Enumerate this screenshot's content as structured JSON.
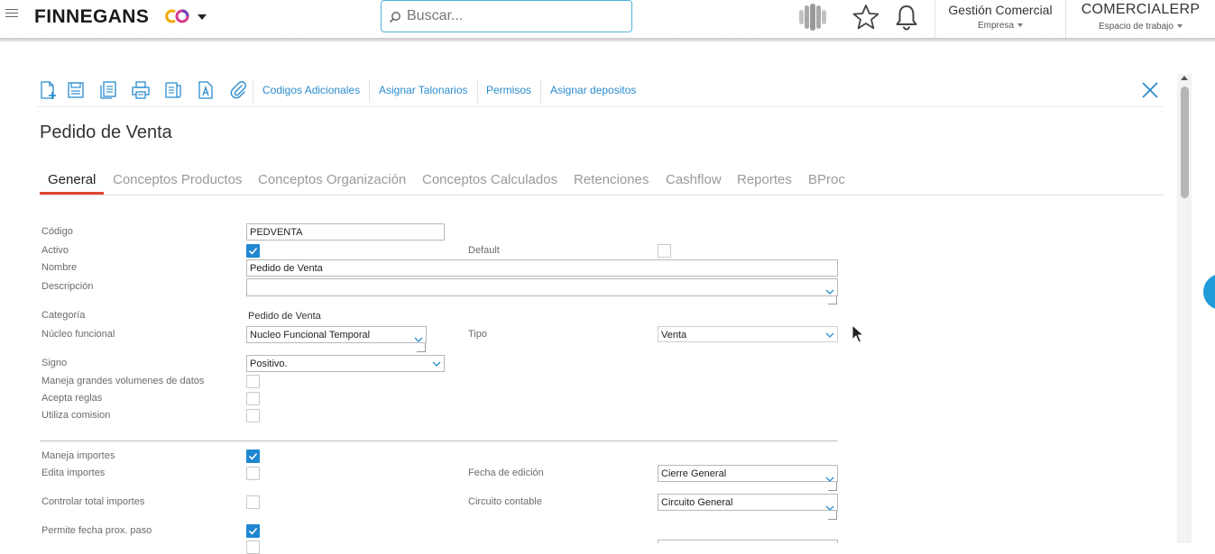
{
  "header": {
    "brand": "FINNEGANS",
    "search_placeholder": "Buscar...",
    "company": {
      "name": "Gestión Comercial",
      "label": "Empresa"
    },
    "workspace": {
      "name": "COMERCIALERP",
      "label": "Espacio de trabajo"
    },
    "icons": [
      "hamburger-icon",
      "finnegans-logo",
      "search-icon",
      "spinner-icon",
      "star-icon",
      "bell-icon"
    ]
  },
  "toolbar": {
    "icons": [
      "new-document-icon",
      "save-icon",
      "copy-icon",
      "print-icon",
      "report-icon",
      "text-icon",
      "attach-icon"
    ],
    "links": [
      "Codigos Adicionales",
      "Asignar Talonarios",
      "Permisos",
      "Asignar depositos"
    ]
  },
  "page_title": "Pedido de Venta",
  "tabs": [
    "General",
    "Conceptos Productos",
    "Conceptos Organización",
    "Conceptos Calculados",
    "Retenciones",
    "Cashflow",
    "Reportes",
    "BProc"
  ],
  "active_tab": "General",
  "form": {
    "codigo": {
      "label": "Código",
      "value": "PEDVENTA"
    },
    "activo": {
      "label": "Activo",
      "checked": true
    },
    "default": {
      "label": "Default",
      "checked": false
    },
    "nombre": {
      "label": "Nombre",
      "value": "Pedido de Venta"
    },
    "descripcion": {
      "label": "Descripción",
      "value": ""
    },
    "categoria": {
      "label": "Categoría",
      "value": "Pedido de Venta"
    },
    "nucleo": {
      "label": "Núcleo funcional",
      "value": "Nucleo Funcional Temporal"
    },
    "tipo": {
      "label": "Tipo",
      "value": "Venta"
    },
    "signo": {
      "label": "Signo",
      "value": "Positivo."
    },
    "grandes_volumenes": {
      "label": "Maneja grandes volumenes de datos",
      "checked": false
    },
    "acepta_reglas": {
      "label": "Acepta reglas",
      "checked": false
    },
    "utiliza_comision": {
      "label": "Utiliza comision",
      "checked": false
    },
    "maneja_importes": {
      "label": "Maneja importes",
      "checked": true
    },
    "edita_importes": {
      "label": "Edita importes",
      "checked": false
    },
    "fecha_edicion": {
      "label": "Fecha de edición",
      "value": "Cierre General"
    },
    "controlar_total": {
      "label": "Controlar total importes",
      "checked": false
    },
    "circuito_contable": {
      "label": "Circuito contable",
      "value": "Circuito General"
    },
    "permite_fecha": {
      "label": "Permite fecha prox. paso",
      "checked": true
    }
  },
  "colors": {
    "accent": "#1f87d1",
    "link": "#2a8ccf",
    "tab_active_underline": "#e0452e",
    "search_border": "#52b6dd"
  }
}
